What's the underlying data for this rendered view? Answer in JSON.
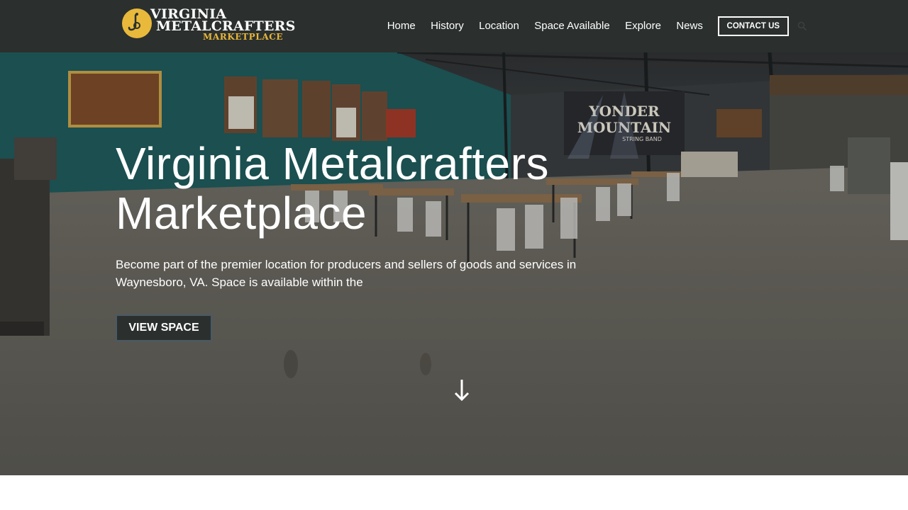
{
  "logo": {
    "line1": "VIRGINIA",
    "line2": "METALCRAFTERS",
    "line3": "MARKETPLACE",
    "badge_color": "#e9b93b",
    "icon": "bell-logo-icon"
  },
  "nav": {
    "items": [
      {
        "label": "Home"
      },
      {
        "label": "History"
      },
      {
        "label": "Location"
      },
      {
        "label": "Space Available"
      },
      {
        "label": "Explore"
      },
      {
        "label": "News"
      }
    ],
    "contact_label": "CONTACT US",
    "search_icon": "search-icon"
  },
  "hero": {
    "title_line1": "Virginia Metalcrafters",
    "title_line2": "Marketplace",
    "subtitle": "Become part of the premier location for producers and sellers of goods and services in Waynesboro, VA. Space is available within the",
    "button_label": "VIEW SPACE",
    "scroll_icon": "arrow-down-icon",
    "sign_line1": "YONDER",
    "sign_line2": "MOUNTAIN",
    "sign_line3": "STRING BAND"
  },
  "colors": {
    "header_bg": "#2b302e",
    "accent_gold": "#e8b73a",
    "button_bg": "#2b302e",
    "wall_teal": "#1f5a5c"
  }
}
